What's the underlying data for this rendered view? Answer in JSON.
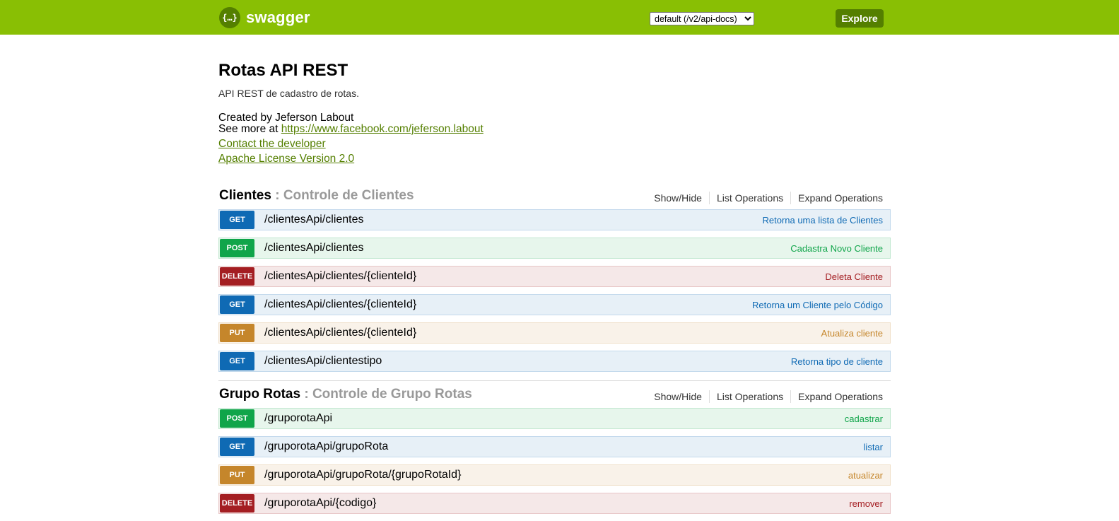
{
  "topbar": {
    "logo_symbol": "{…}",
    "logo_text": "swagger",
    "spec_select_value": "default (/v2/api-docs)",
    "explore_label": "Explore",
    "colors": {
      "bar": "#89bf04",
      "dark": "#547f00"
    }
  },
  "info": {
    "title": "Rotas API REST",
    "description": "API REST de cadastro de rotas.",
    "created_by": "Created by Jeferson Labout",
    "see_more_prefix": "See more at ",
    "see_more_link": "https://www.facebook.com/jeferson.labout",
    "contact_link": "Contact the developer",
    "license_link": "Apache License Version 2.0"
  },
  "resources": [
    {
      "name": "Clientes",
      "separator": " : ",
      "description": "Controle de Clientes",
      "show_hide": "Show/Hide",
      "list_operations": "List Operations",
      "expand_operations": "Expand Operations",
      "operations": [
        {
          "method": "GET",
          "path": "/clientesApi/clientes",
          "summary": "Retorna uma lista de Clientes"
        },
        {
          "method": "POST",
          "path": "/clientesApi/clientes",
          "summary": "Cadastra Novo Cliente"
        },
        {
          "method": "DELETE",
          "path": "/clientesApi/clientes/{clienteId}",
          "summary": "Deleta Cliente"
        },
        {
          "method": "GET",
          "path": "/clientesApi/clientes/{clienteId}",
          "summary": "Retorna um Cliente pelo Código"
        },
        {
          "method": "PUT",
          "path": "/clientesApi/clientes/{clienteId}",
          "summary": "Atualiza cliente"
        },
        {
          "method": "GET",
          "path": "/clientesApi/clientestipo",
          "summary": "Retorna tipo de cliente"
        }
      ]
    },
    {
      "name": "Grupo Rotas",
      "separator": " : ",
      "description": "Controle de Grupo Rotas",
      "show_hide": "Show/Hide",
      "list_operations": "List Operations",
      "expand_operations": "Expand Operations",
      "operations": [
        {
          "method": "POST",
          "path": "/gruporotaApi",
          "summary": "cadastrar"
        },
        {
          "method": "GET",
          "path": "/gruporotaApi/grupoRota",
          "summary": "listar"
        },
        {
          "method": "PUT",
          "path": "/gruporotaApi/grupoRota/{grupoRotaId}",
          "summary": "atualizar"
        },
        {
          "method": "DELETE",
          "path": "/gruporotaApi/{codigo}",
          "summary": "remover"
        }
      ]
    }
  ],
  "method_colors": {
    "GET": "#0f6ab4",
    "POST": "#10a54a",
    "DELETE": "#a41e22",
    "PUT": "#c5862b"
  }
}
